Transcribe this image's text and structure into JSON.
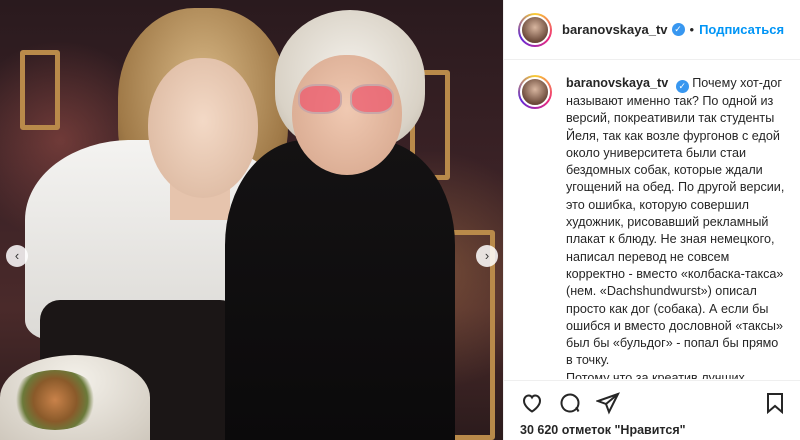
{
  "post": {
    "image_alt": "Two women seated at an event table",
    "carousel": {
      "prev_icon": "chevron-left-icon",
      "next_icon": "chevron-right-icon",
      "prev_glyph": "‹",
      "next_glyph": "›"
    }
  },
  "header": {
    "username": "baranovskaya_tv",
    "verified_glyph": "✓",
    "separator": "•",
    "follow_label": "Подписаться"
  },
  "caption": {
    "username": "baranovskaya_tv",
    "text": "Почему хот-дог называют именно так? По одной из версий, покреативили так студенты Йеля, так как возле фургонов с едой около университета были стаи бездомных собак, которые ждали угощений на обед. По другой версии, это ошибка, которую совершил художник, рисовавший рекламный плакат к блюду. Не зная немецкого, написал перевод не совсем корректно - вместо «колбаска-такса» (нем. «Dachshundwurst») описал просто как дог (собака). А если бы ошибся и вместо дословной «таксы» был бы «бульдог» - попал бы прямо в точку.\nПотому что за креатив лучших московских хот-догов теперь"
  },
  "actions": {
    "like_icon": "heart-icon",
    "comment_icon": "comment-icon",
    "share_icon": "share-icon",
    "save_icon": "bookmark-icon"
  },
  "likes": {
    "text": "30 620 отметок \"Нравится\""
  },
  "colors": {
    "accent": "#0095f6",
    "verified": "#3897f0",
    "text": "#262626",
    "border": "#efefef"
  }
}
